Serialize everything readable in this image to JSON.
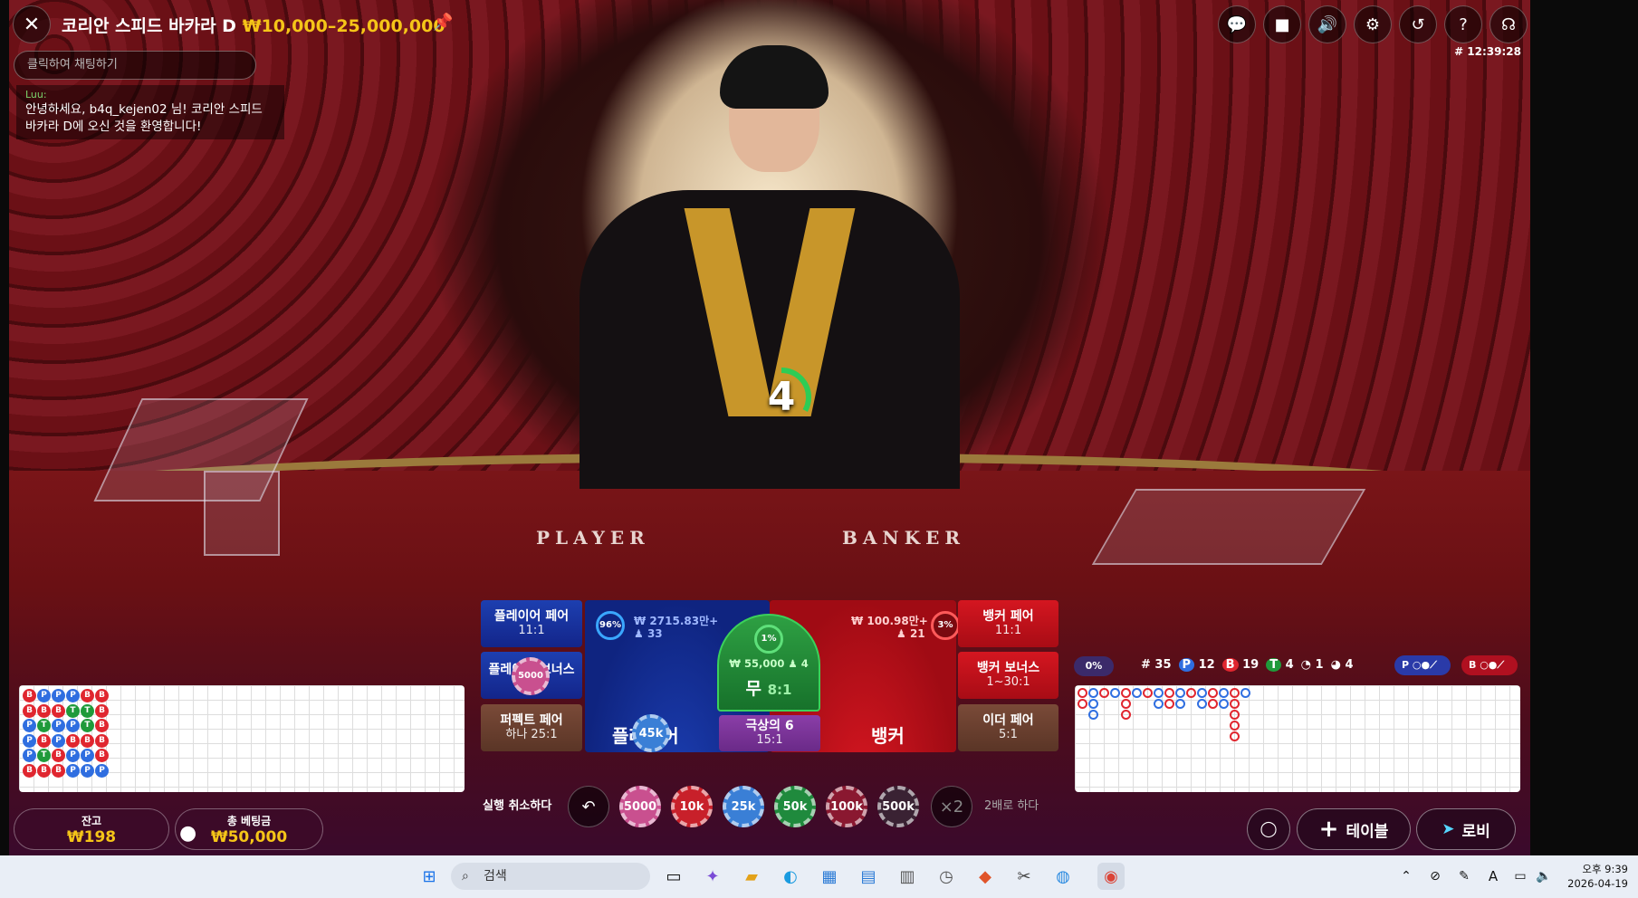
{
  "header": {
    "title": "코리안 스피드 바카라 D",
    "limits": "₩10,000–25,000,000",
    "game_id": "# 12:39:28"
  },
  "chat": {
    "placeholder": "클릭하여 채팅하기",
    "message_author": "Luu:",
    "message_text": "안녕하세요, b4q_kejen02 님! 코리안 스피드 바카라 D에 오신 것을 환영합니다!"
  },
  "top_icons": [
    "chat-icon",
    "video-icon",
    "sound-icon",
    "settings-icon",
    "history-icon",
    "help-icon",
    "support-icon"
  ],
  "table": {
    "player_word": "PLAYER",
    "banker_word": "BANKER"
  },
  "countdown": {
    "value": "4",
    "progress": 0.33
  },
  "bets": {
    "player_pair": {
      "label": "플레이어 페어",
      "odds": "11:1"
    },
    "player_bonus": {
      "label": "플레이어 보너스",
      "odds": ""
    },
    "perfect_pair": {
      "label": "퍼펙트 페어",
      "odds": "하나 25:1"
    },
    "player": {
      "label": "플레이어",
      "pct": "96%",
      "amount": "₩ 2715.83만+",
      "players": "33"
    },
    "tie": {
      "pct": "1%",
      "amount": "₩ 55,000",
      "players": "4",
      "label": "무",
      "odds": "8:1"
    },
    "super6": {
      "label": "극상의 6",
      "odds": "15:1"
    },
    "banker": {
      "label": "뱅커",
      "pct": "3%",
      "amount": "₩ 100.98만+",
      "players": "21"
    },
    "banker_pair": {
      "label": "뱅커 페어",
      "odds": "11:1"
    },
    "banker_bonus": {
      "label": "뱅커 보너스",
      "odds": "1~30:1"
    },
    "either_pair": {
      "label": "이더 페어",
      "odds": "5:1"
    },
    "placed_chips": {
      "player_bonus": "5000",
      "player": "45k"
    }
  },
  "controls": {
    "undo_label": "실행 취소하다",
    "double_label": "2배로 하다",
    "double_icon": "×2",
    "chips": [
      {
        "value": "5000",
        "color": "#c9508f"
      },
      {
        "value": "10k",
        "color": "#c8202a"
      },
      {
        "value": "25k",
        "color": "#3a7fd6"
      },
      {
        "value": "50k",
        "color": "#1f8a3d"
      },
      {
        "value": "100k",
        "color": "#8a1830"
      },
      {
        "value": "500k",
        "color": "#3a2233"
      }
    ]
  },
  "stats": {
    "banker_pct": "0%",
    "rounds": "# 35",
    "player_wins": "12",
    "banker_wins": "19",
    "ties": "4",
    "player_pairs": "1",
    "banker_pairs": "4"
  },
  "bead_road": [
    [
      "B",
      "P",
      "P",
      "P",
      "B",
      "B"
    ],
    [
      "B",
      "B",
      "B",
      "T",
      "T",
      "B"
    ],
    [
      "P",
      "T",
      "P",
      "P",
      "T",
      "B"
    ],
    [
      "P",
      "B",
      "P",
      "B",
      "B",
      "B"
    ],
    [
      "P",
      "T",
      "B",
      "P",
      "P",
      "B"
    ],
    [
      "B",
      "B",
      "B",
      "P",
      "P",
      "P"
    ]
  ],
  "footer": {
    "balance_label": "잔고",
    "balance_value": "₩198",
    "total_bet_label": "총 베팅금",
    "total_bet_value": "₩50,000",
    "table_button": "테이블",
    "lobby_button": "로비"
  },
  "taskbar": {
    "search_placeholder": "검색",
    "time": "오후 9:39",
    "date": "2026-04-19",
    "ime": "A"
  }
}
